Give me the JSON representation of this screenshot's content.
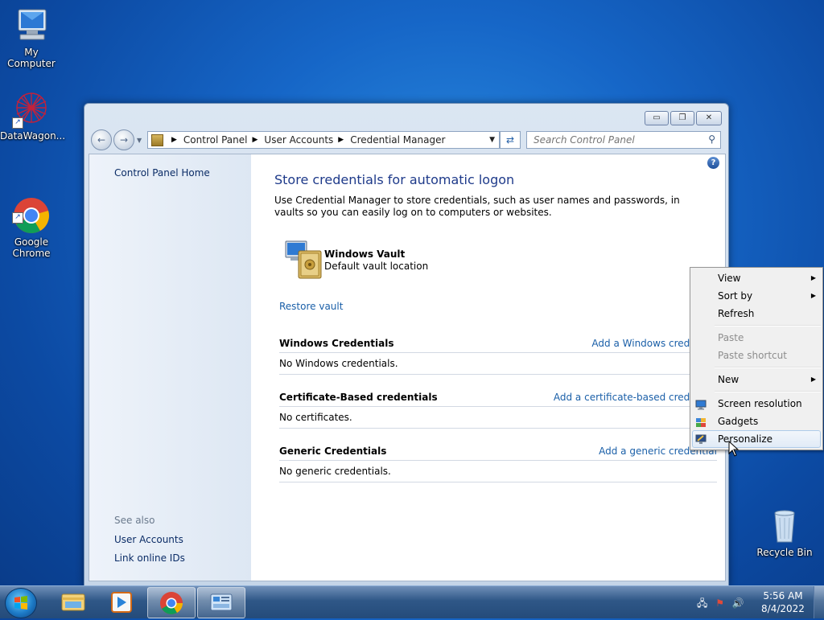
{
  "desktop": {
    "icons": [
      {
        "label": "My Computer"
      },
      {
        "label": "DataWagon..."
      },
      {
        "label": "Google\nChrome"
      },
      {
        "label": "Recycle Bin"
      }
    ]
  },
  "window": {
    "controls": {
      "minimize": "▭",
      "maximize": "❐",
      "close": "✕"
    },
    "breadcrumb": [
      "Control Panel",
      "User Accounts",
      "Credential Manager"
    ],
    "search_placeholder": "Search Control Panel",
    "sidebar": {
      "home": "Control Panel Home",
      "see_also": "See also",
      "links": [
        "User Accounts",
        "Link online IDs"
      ]
    },
    "main": {
      "title": "Store credentials for automatic logon",
      "description": "Use Credential Manager to store credentials, such as user names and passwords, in vaults so you can easily log on to computers or websites.",
      "vault_name": "Windows Vault",
      "vault_sub": "Default vault location",
      "restore": "Restore vault",
      "sections": [
        {
          "title": "Windows Credentials",
          "add": "Add a Windows credential",
          "empty": "No Windows credentials."
        },
        {
          "title": "Certificate-Based credentials",
          "add": "Add a certificate-based credential",
          "empty": "No certificates."
        },
        {
          "title": "Generic Credentials",
          "add": "Add a generic credential",
          "empty": "No generic credentials."
        }
      ]
    }
  },
  "context_menu": {
    "items": [
      {
        "label": "View",
        "submenu": true
      },
      {
        "label": "Sort by",
        "submenu": true
      },
      {
        "label": "Refresh"
      },
      {
        "label": "Paste",
        "disabled": true
      },
      {
        "label": "Paste shortcut",
        "disabled": true
      },
      {
        "label": "New",
        "submenu": true
      },
      {
        "label": "Screen resolution",
        "icon": "monitor-icon"
      },
      {
        "label": "Gadgets",
        "icon": "gadgets-icon"
      },
      {
        "label": "Personalize",
        "icon": "personalize-icon",
        "highlighted": true
      }
    ]
  },
  "taskbar": {
    "time": "5:56 AM",
    "date": "8/4/2022",
    "pinned": [
      "windows-explorer-icon",
      "media-player-icon",
      "chrome-icon",
      "control-panel-icon"
    ]
  }
}
